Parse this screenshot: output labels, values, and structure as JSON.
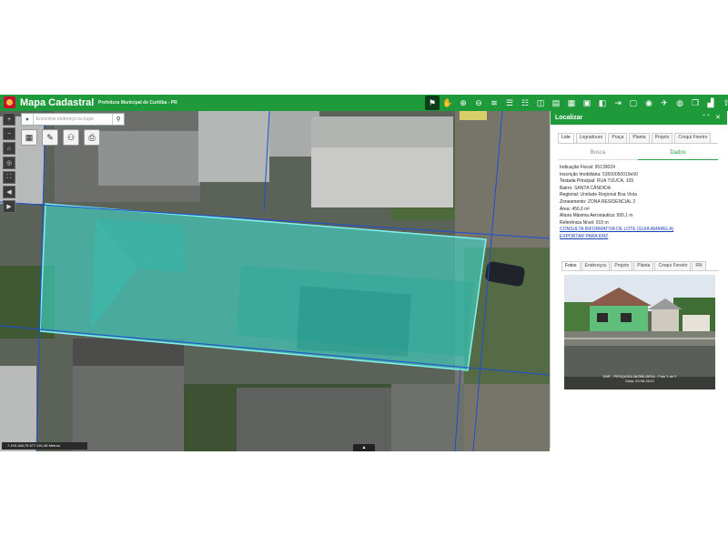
{
  "header": {
    "title": "Mapa Cadastral",
    "subtitle": "Prefeitura Municipal de Curitiba - PR",
    "tools": [
      {
        "icon": "identify-icon",
        "glyph": "⚑",
        "active": true
      },
      {
        "icon": "pan-icon",
        "glyph": "✋",
        "active": false
      },
      {
        "icon": "zoom-in-icon",
        "glyph": "⊕",
        "active": false
      },
      {
        "icon": "zoom-out-icon",
        "glyph": "⊖",
        "active": false
      },
      {
        "icon": "layers-icon",
        "glyph": "≋",
        "active": false
      },
      {
        "icon": "list-icon",
        "glyph": "☰",
        "active": false
      },
      {
        "icon": "legend-icon",
        "glyph": "☷",
        "active": false
      },
      {
        "icon": "measure-icon",
        "glyph": "◫",
        "active": false
      },
      {
        "icon": "book-icon",
        "glyph": "▤",
        "active": false
      },
      {
        "icon": "table-icon",
        "glyph": "▦",
        "active": false
      },
      {
        "icon": "select-icon",
        "glyph": "▣",
        "active": false
      },
      {
        "icon": "split-icon",
        "glyph": "◧",
        "active": false
      },
      {
        "icon": "export-icon",
        "glyph": "⇥",
        "active": false
      },
      {
        "icon": "frame-icon",
        "glyph": "▢",
        "active": false
      },
      {
        "icon": "location-icon",
        "glyph": "◉",
        "active": false
      },
      {
        "icon": "pin-icon",
        "glyph": "✈",
        "active": false
      },
      {
        "icon": "globe-icon",
        "glyph": "◍",
        "active": false
      },
      {
        "icon": "pages-icon",
        "glyph": "❐",
        "active": false
      },
      {
        "icon": "building-icon",
        "glyph": "▟",
        "active": false
      },
      {
        "icon": "upload-icon",
        "glyph": "⇧",
        "active": false
      },
      {
        "icon": "share-icon",
        "glyph": "↗",
        "active": false
      },
      {
        "icon": "info-icon",
        "glyph": "ⓘ",
        "active": false
      }
    ]
  },
  "map": {
    "search_placeholder": "Encontrar endereço ou lugar",
    "scale_text": "7.193.166,79 677.241,98 Metros"
  },
  "panel": {
    "title": "Localizar",
    "tabs": [
      "Lote",
      "Logradouro",
      "Praça",
      "Planta",
      "Projeto",
      "Croqui Foreiro"
    ],
    "active_tab": 0,
    "subtabs": [
      "Busca",
      "Dados"
    ],
    "active_subtab": 1,
    "info_rows": [
      {
        "label": "Indicação Fiscal:",
        "value": " 95139024"
      },
      {
        "label": "Inscrição Imobiliária:",
        "value": " 53500050019e00"
      },
      {
        "label": "Testada Principal:",
        "value": " RUA TIJUCA, 109"
      },
      {
        "label": "Bairro:",
        "value": " SANTA CÂNDIDA"
      },
      {
        "label": "Regional:",
        "value": " Unidade Regional Boa Vista"
      },
      {
        "label": "Zoneamento:",
        "value": " ZONA RESIDENCIAL 2"
      },
      {
        "label": "Área:",
        "value": " 456,6 m²"
      },
      {
        "label": "Altura Máxima Aeronáutica:",
        "value": " 995,1 m"
      },
      {
        "label": "Referência Nível:",
        "value": " 919 m"
      }
    ],
    "links": [
      "CONSULTA INFORMATIVA DE LOTE (GUIA AMARELA)",
      "EXPORTAR PARA KMZ"
    ],
    "photo_tabs": [
      "Fotos",
      "Endereços",
      "Projeto",
      "Planta",
      "Croqui Foreiro",
      "RN"
    ],
    "active_photo_tab": 0,
    "photo_caption": "SMF - PESQUISA IMOBILIÁRIA - Foto 1 de 2",
    "photo_date": "Data: 23-06-2013"
  }
}
